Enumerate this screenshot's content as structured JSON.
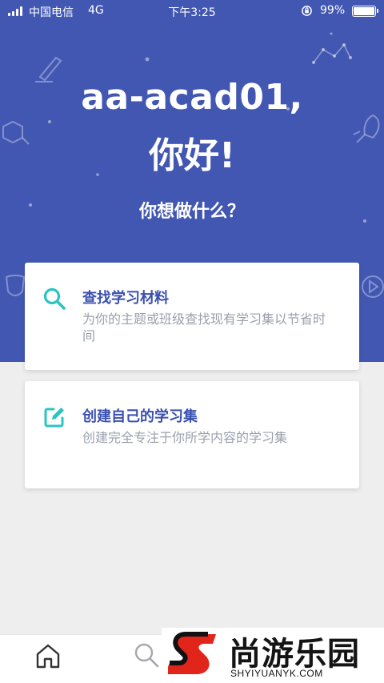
{
  "status_bar": {
    "carrier": "中国电信",
    "network": "4G",
    "time": "下午3:25",
    "battery": "99%"
  },
  "greeting": {
    "name_line": "aa-acad01,",
    "hello_line": "你好!",
    "question": "你想做什么？"
  },
  "cards": [
    {
      "icon": "search-icon",
      "title": "查找学习材料",
      "description": "为你的主题或班级查找现有学习集以节省时间"
    },
    {
      "icon": "edit-icon",
      "title": "创建自己的学习集",
      "description": "创建完全专注于你所学内容的学习集"
    }
  ],
  "tabbar": {
    "items": [
      {
        "icon": "home-icon"
      },
      {
        "icon": "search-icon"
      }
    ]
  },
  "watermark": {
    "title": "尚游乐园",
    "subtitle": "SHYIYUANYK.COM"
  },
  "colors": {
    "hero_bg": "#4257b2",
    "accent_teal": "#2bc4c0",
    "title_blue": "#3a50b0",
    "desc_gray": "#9aa0ab",
    "page_bg": "#eeeeef"
  }
}
